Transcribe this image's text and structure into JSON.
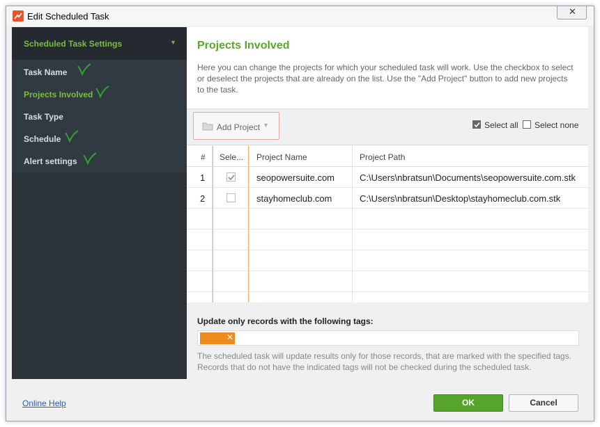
{
  "window": {
    "title": "Edit Scheduled Task",
    "close_label": "✕",
    "app_icon": "seo-powersuite-icon"
  },
  "sidebar": {
    "header": "Scheduled Task Settings",
    "items": [
      {
        "label": "Task Name",
        "checked": true,
        "active": false
      },
      {
        "label": "Projects Involved",
        "checked": true,
        "active": true
      },
      {
        "label": "Task Type",
        "checked": false,
        "active": false
      },
      {
        "label": "Schedule",
        "checked": true,
        "active": false
      },
      {
        "label": "Alert settings",
        "checked": true,
        "active": false
      }
    ]
  },
  "main": {
    "title": "Projects Involved",
    "description": "Here you can change the projects for which your scheduled task will work. Use the checkbox to select or deselect the projects that are already on the list. Use the \"Add Project\" button to add new projects to the task.",
    "toolbar": {
      "add_project": "Add Project",
      "select_all": "Select all",
      "select_none": "Select none"
    },
    "table": {
      "columns": [
        "#",
        "Sele...",
        "Project Name",
        "Project Path"
      ],
      "rows": [
        {
          "num": "1",
          "selected": true,
          "name": "seopowersuite.com",
          "path": "C:\\Users\\nbratsun\\Documents\\seopowersuite.com.stk"
        },
        {
          "num": "2",
          "selected": false,
          "name": "stayhomeclub.com",
          "path": "C:\\Users\\nbratsun\\Desktop\\stayhomeclub.com.stk"
        }
      ]
    },
    "tags": {
      "label": "Update only records with the following tags:",
      "note": "The scheduled task will update results only for those records, that are marked with the specified tags. Records that do not have the indicated tags will not be checked during the scheduled task.",
      "chip_remove": "✕",
      "chip_color": "#ef8a1c"
    }
  },
  "footer": {
    "online_help": "Online Help",
    "ok": "OK",
    "cancel": "Cancel"
  },
  "colors": {
    "accent_green": "#5ba62b",
    "sidebar_bg": "#2b3238",
    "ok_button": "#56a52a"
  }
}
